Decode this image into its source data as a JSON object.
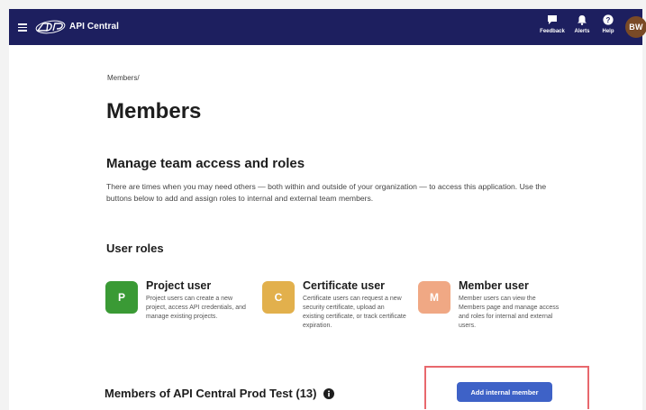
{
  "header": {
    "app_title": "API Central",
    "actions": [
      {
        "label": "Feedback",
        "icon": "feedback-icon"
      },
      {
        "label": "Alerts",
        "icon": "bell-icon"
      },
      {
        "label": "Help",
        "icon": "help-icon"
      }
    ],
    "avatar_initials": "BW",
    "colors": {
      "bar": "#1d1f5f",
      "avatar": "#7a4a26"
    }
  },
  "breadcrumb": "Members/",
  "page_title": "Members",
  "manage_section": {
    "title": "Manage team access and roles",
    "description": "There are times when you may need others — both within and outside of your organization — to access this application. Use the buttons below to add and assign roles to internal and external team members."
  },
  "roles_section": {
    "title": "User roles",
    "roles": [
      {
        "badge": "P",
        "name": "Project user",
        "description": "Project users can create a new project, access API credentials, and manage existing projects.",
        "color": "#3a9a35"
      },
      {
        "badge": "C",
        "name": "Certificate user",
        "description": "Certificate users can request a new security certificate, upload an existing certificate, or track certificate expiration.",
        "color": "#e2b04c"
      },
      {
        "badge": "M",
        "name": "Member user",
        "description": "Member users can view the Members page and manage access and roles for internal and external users.",
        "color": "#f0a884"
      }
    ]
  },
  "members_list": {
    "title": "Members of API Central Prod Test (13)",
    "add_internal_label": "Add internal member",
    "accent_color": "#3e62c7",
    "highlight_color": "#e8686d"
  }
}
